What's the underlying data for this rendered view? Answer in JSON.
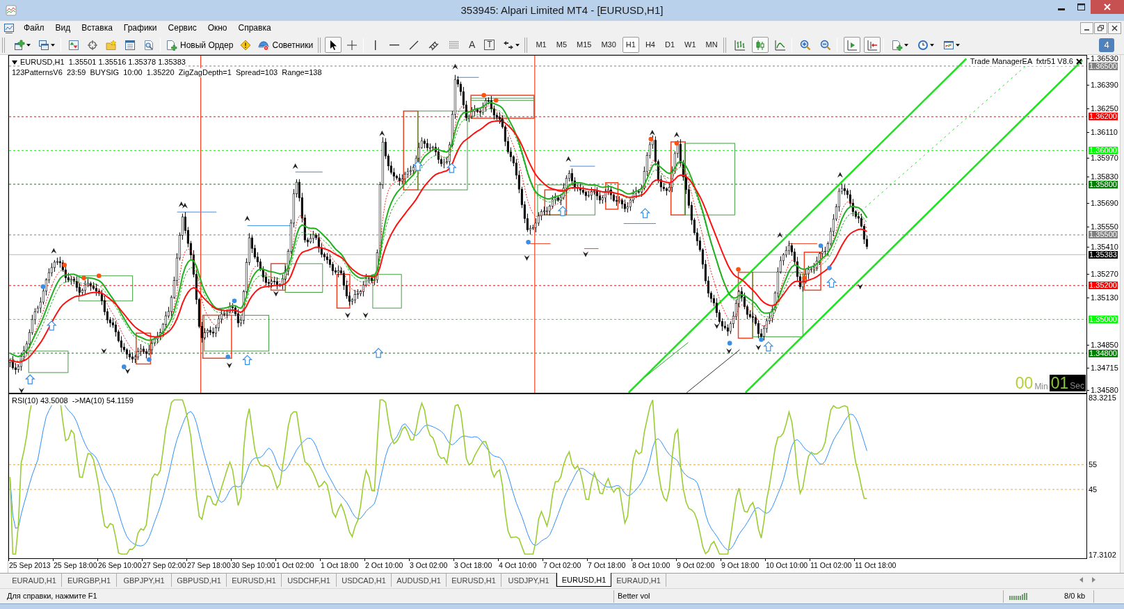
{
  "window": {
    "title": "353945: Alpari Limited MT4 - [EURUSD,H1]"
  },
  "menu": [
    "Файл",
    "Вид",
    "Вставка",
    "Графики",
    "Сервис",
    "Окно",
    "Справка"
  ],
  "toolbar": {
    "new_order": "Новый Ордер",
    "experts": "Советники",
    "pointer_modes": [
      {
        "kind": "cursor",
        "selected": true
      },
      {
        "kind": "crosshair",
        "selected": false
      }
    ],
    "text_tool": "A",
    "label_tool": "T",
    "timeframes": [
      {
        "label": "M1",
        "selected": false
      },
      {
        "label": "M5",
        "selected": false
      },
      {
        "label": "M15",
        "selected": false
      },
      {
        "label": "M30",
        "selected": false
      },
      {
        "label": "H1",
        "selected": true
      },
      {
        "label": "H4",
        "selected": false
      },
      {
        "label": "D1",
        "selected": false
      },
      {
        "label": "W1",
        "selected": false
      },
      {
        "label": "MN",
        "selected": false
      }
    ],
    "chart_types": [
      {
        "kind": "bars",
        "selected": false
      },
      {
        "kind": "candles",
        "selected": true
      },
      {
        "kind": "line",
        "selected": false
      }
    ],
    "scroll_toggles": [
      {
        "kind": "shift",
        "on": true
      },
      {
        "kind": "autoscroll",
        "on": true
      }
    ],
    "messages_count": "4"
  },
  "chart": {
    "header": "EURUSD,H1  1.35501 1.35516 1.35378 1.35383",
    "indicator_info": "123PatternsV6  23:59  BUYSIG  10:00  1.35220  ZigZagDepth=1  Spread=103  Range=138",
    "ea_label": "Trade ManagerEA  fxtr51 V8.6",
    "price_ticks": [
      "1.36530",
      "1.36390",
      "1.36250",
      "1.36110",
      "1.35970",
      "1.35830",
      "1.35690",
      "1.35550",
      "1.35410",
      "1.35270",
      "1.35130",
      "1.34850",
      "1.34715",
      "1.34580"
    ],
    "price_levels": [
      {
        "label": "1.36500",
        "kind": "level",
        "color": "#808080"
      },
      {
        "label": "1.36200",
        "kind": "level",
        "color": "#ff0000"
      },
      {
        "label": "1.36000",
        "kind": "level",
        "color": "#00ff00"
      },
      {
        "label": "1.35800",
        "kind": "level",
        "color": "#008000"
      },
      {
        "label": "1.35500",
        "kind": "level",
        "color": "#808080"
      },
      {
        "label": "1.35383",
        "kind": "bid",
        "color": "#000000"
      },
      {
        "label": "1.35200",
        "kind": "level",
        "color": "#ff0000"
      },
      {
        "label": "1.35000",
        "kind": "level",
        "color": "#00ff00"
      },
      {
        "label": "1.34800",
        "kind": "level",
        "color": "#008000"
      }
    ],
    "timer": {
      "minutes": "00",
      "minutes_unit": "Min",
      "seconds": "01",
      "seconds_unit": "Sec"
    }
  },
  "rsi": {
    "header": "RSI(10) 43.5008  ->MA(10) 54.1159",
    "axis_labels": [
      "83.3215",
      "55",
      "45",
      "17.3102"
    ]
  },
  "time_axis": [
    "25 Sep 2013",
    "25 Sep 18:00",
    "26 Sep 10:00",
    "27 Sep 02:00",
    "27 Sep 18:00",
    "30 Sep 10:00",
    "1 Oct 02:00",
    "1 Oct 18:00",
    "2 Oct 10:00",
    "3 Oct 02:00",
    "3 Oct 18:00",
    "4 Oct 10:00",
    "7 Oct 02:00",
    "7 Oct 18:00",
    "8 Oct 10:00",
    "9 Oct 02:00",
    "9 Oct 18:00",
    "10 Oct 10:00",
    "11 Oct 02:00",
    "11 Oct 18:00"
  ],
  "tabs": [
    {
      "label": "EURAUD,H1",
      "selected": false
    },
    {
      "label": "EURGBP,H1",
      "selected": false
    },
    {
      "label": "GBPJPY,H1",
      "selected": false
    },
    {
      "label": "GBPUSD,H1",
      "selected": false
    },
    {
      "label": "EURUSD,H1",
      "selected": false
    },
    {
      "label": "USDCHF,H1",
      "selected": false
    },
    {
      "label": "USDCAD,H1",
      "selected": false
    },
    {
      "label": "AUDUSD,H1",
      "selected": false
    },
    {
      "label": "EURUSD,H1",
      "selected": false
    },
    {
      "label": "USDJPY,H1",
      "selected": false
    },
    {
      "label": "EURUSD,H1",
      "selected": true
    },
    {
      "label": "EURAUD,H1",
      "selected": false
    }
  ],
  "status_bar": {
    "help": "Для справки, нажмите F1",
    "profile": "Better vol",
    "traffic": "8/0 kb"
  }
}
